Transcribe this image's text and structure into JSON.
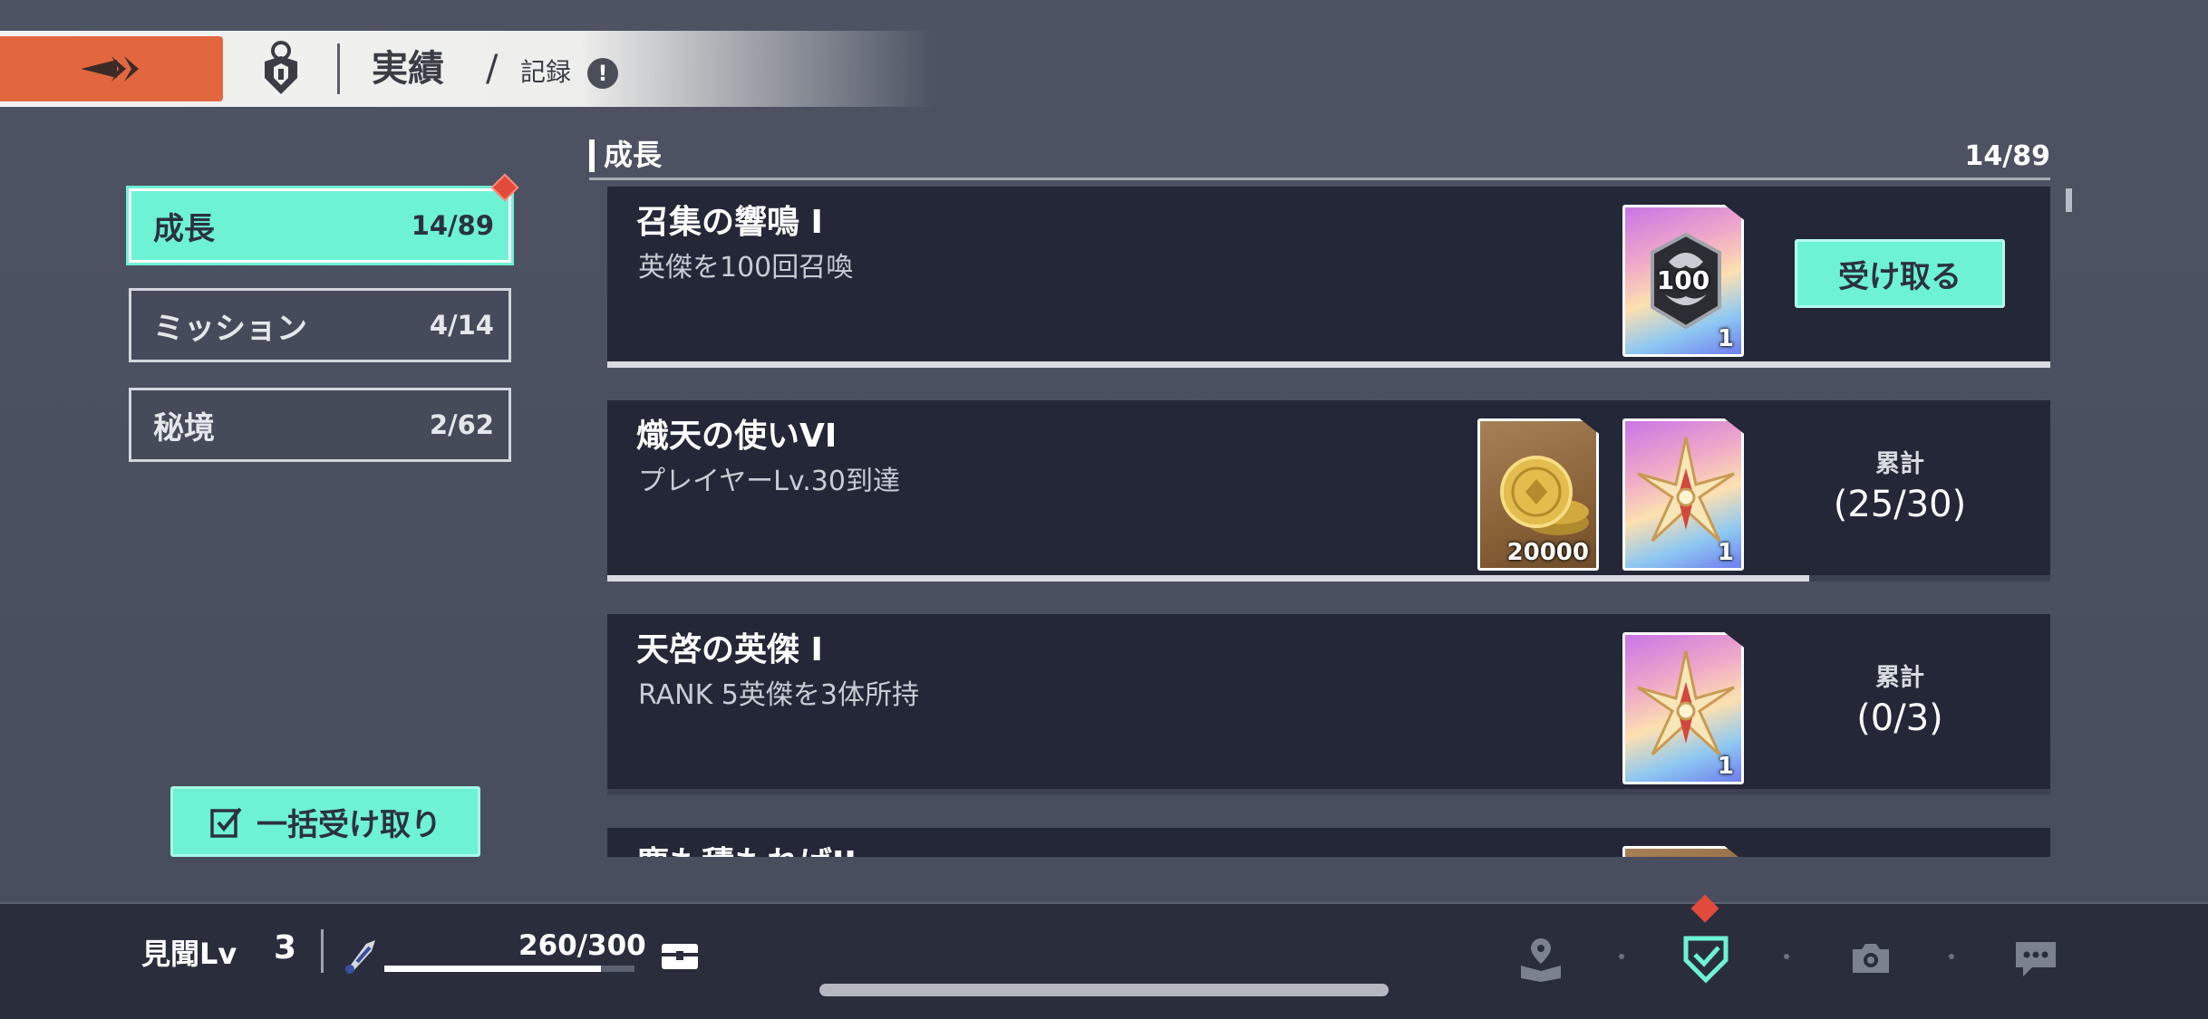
{
  "header": {
    "title": "実績",
    "separator": "/",
    "subtitle": "記録",
    "info_symbol": "!"
  },
  "categories": [
    {
      "label": "成長",
      "count": "14/89",
      "active": true
    },
    {
      "label": "ミッション",
      "count": "4/14",
      "active": false
    },
    {
      "label": "秘境",
      "count": "2/62",
      "active": false
    }
  ],
  "bulk_claim": {
    "label": "一括受け取り",
    "icon": "checklist-icon"
  },
  "section": {
    "title": "成長",
    "count": "14/89"
  },
  "achievements": [
    {
      "title": "召集の響鳴 I",
      "description": "英傑を100回召喚",
      "rewards": [
        {
          "icon": "summon-ticket-icon",
          "style": "holo",
          "qty": "1",
          "emblem": "100"
        }
      ],
      "action": {
        "type": "claim",
        "label": "受け取る"
      },
      "progress": 1.0
    },
    {
      "title": "熾天の使いVI",
      "description": "プレイヤーLv.30到達",
      "rewards": [
        {
          "icon": "gold-coin-icon",
          "style": "gold",
          "qty": "20000"
        },
        {
          "icon": "angel-emblem-icon",
          "style": "holo",
          "qty": "1"
        }
      ],
      "action": {
        "type": "progress",
        "label": "累計",
        "value": "(25/30)"
      },
      "progress": 0.833
    },
    {
      "title": "天啓の英傑 I",
      "description": "RANK 5英傑を3体所持",
      "rewards": [
        {
          "icon": "angel-emblem-icon",
          "style": "holo",
          "qty": "1"
        }
      ],
      "action": {
        "type": "progress",
        "label": "累計",
        "value": "(0/3)"
      },
      "progress": 0.0
    },
    {
      "title": "塵も積もればII",
      "description": "",
      "rewards": [
        {
          "icon": "gold-coin-icon",
          "style": "gold",
          "qty": ""
        }
      ],
      "action": {
        "type": "none"
      },
      "progress": 0.0
    }
  ],
  "status": {
    "level_label": "見聞Lv",
    "level_value": "3",
    "xp_text": "260/300",
    "xp_fraction": 0.867
  },
  "bottom_nav": [
    {
      "icon": "book-map-icon"
    },
    {
      "icon": "achievement-shield-icon",
      "active": true
    },
    {
      "icon": "camera-icon"
    },
    {
      "icon": "chat-icon"
    }
  ],
  "colors": {
    "accent": "#6ef2d4",
    "back_button": "#e2673f",
    "card_bg": "#232737",
    "badge": "#e24a3b"
  }
}
